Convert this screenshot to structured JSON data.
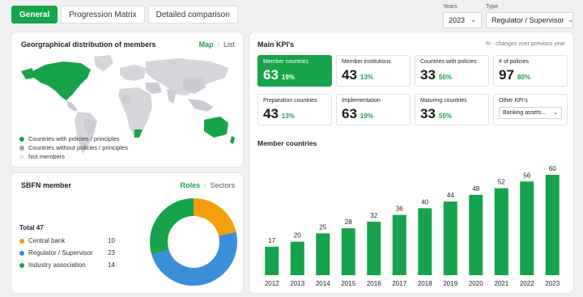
{
  "tabs": [
    {
      "label": "General"
    },
    {
      "label": "Progression Matrix"
    },
    {
      "label": "Detailed comparison"
    }
  ],
  "filters": {
    "years": {
      "label": "Years",
      "value": "2023"
    },
    "type": {
      "label": "Type",
      "value": "Regulator / Supervisor"
    }
  },
  "map_card": {
    "title": "Georgraphical distribution of members",
    "toggle": [
      "Map",
      "List"
    ],
    "legend": [
      {
        "label": "Countries with policies  / principles",
        "color": "#16a34a"
      },
      {
        "label": "Countries without policies  / principles",
        "color": "#9ca3af"
      },
      {
        "label": "Not members",
        "color": "#e5e7eb"
      }
    ]
  },
  "sbfn_card": {
    "title": "SBFN member",
    "toggle": [
      "Roles",
      "Sectors"
    ],
    "total": "Total 47",
    "members": [
      {
        "label": "Central bank",
        "value": 10,
        "color": "#f59e0b"
      },
      {
        "label": "Regulator / Supervisor",
        "value": 23,
        "color": "#3b8ed8"
      },
      {
        "label": "Industry association",
        "value": 14,
        "color": "#16a34a"
      }
    ]
  },
  "kpi_card": {
    "title": "Main KPI's",
    "note": "% - changes over previous year",
    "kpis": [
      {
        "label": "Member countries",
        "value": "63",
        "change": "19%"
      },
      {
        "label": "Member institutions",
        "value": "43",
        "change": "13%"
      },
      {
        "label": "Countries with policies",
        "value": "33",
        "change": "50%"
      },
      {
        "label": "# of policies",
        "value": "97",
        "change": "80%"
      },
      {
        "label": "Preparation countries",
        "value": "43",
        "change": "13%"
      },
      {
        "label": "Implementation",
        "value": "63",
        "change": "19%"
      },
      {
        "label": "Maturing countries",
        "value": "33",
        "change": "50%"
      }
    ],
    "other": {
      "label": "Other KPI's",
      "select": "Banking assets..."
    },
    "chart_title": "Member countries"
  },
  "colors": {
    "accent": "#16a34a",
    "bar": "#16a34a"
  },
  "chart_data": {
    "type": "bar",
    "title": "Member countries",
    "categories": [
      "2012",
      "2013",
      "2014",
      "2015",
      "2016",
      "2017",
      "2018",
      "2019",
      "2020",
      "2021",
      "2022",
      "2023"
    ],
    "values": [
      17,
      20,
      25,
      28,
      32,
      36,
      40,
      44,
      48,
      52,
      56,
      60
    ],
    "ylim": [
      0,
      60
    ],
    "grid": false
  }
}
